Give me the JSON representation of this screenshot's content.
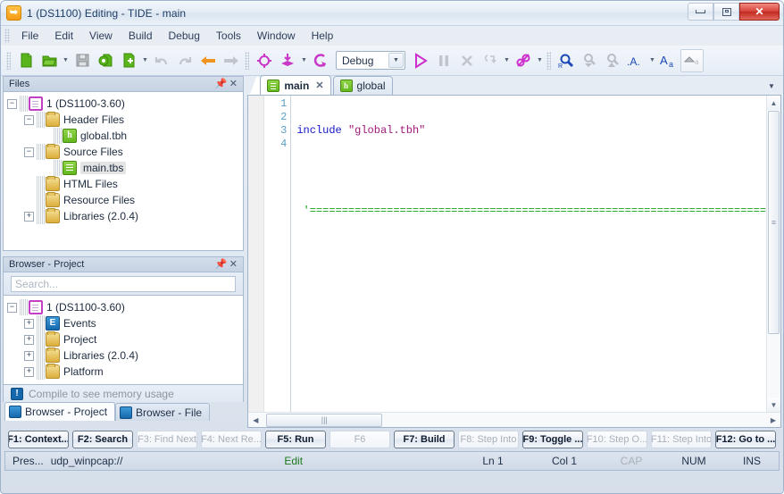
{
  "window": {
    "title": "1 (DS1100) Editing - TIDE - main",
    "app_icon": "tide-logo-icon",
    "controls": {
      "minimize": "minimize-icon",
      "maximize": "maximize-icon",
      "close": "✕"
    }
  },
  "menu": {
    "items": [
      "File",
      "Edit",
      "View",
      "Build",
      "Debug",
      "Tools",
      "Window",
      "Help"
    ]
  },
  "toolbar": {
    "groups": [
      {
        "buttons": [
          {
            "name": "new-file-button",
            "icon": "new-file-icon",
            "dropdown": false
          },
          {
            "name": "open-file-button",
            "icon": "open-folder-icon",
            "dropdown": true
          },
          {
            "name": "save-button",
            "icon": "save-disk-icon",
            "dropdown": false
          },
          {
            "name": "project-settings-button",
            "icon": "file-gear-icon",
            "dropdown": false
          },
          {
            "name": "add-file-button",
            "icon": "file-plus-icon",
            "dropdown": true
          },
          {
            "name": "undo-button",
            "icon": "undo-arrow-icon",
            "dropdown": false
          },
          {
            "name": "redo-button",
            "icon": "redo-arrow-icon",
            "dropdown": false
          },
          {
            "name": "back-button",
            "icon": "arrow-left-icon",
            "dropdown": false
          },
          {
            "name": "forward-button",
            "icon": "arrow-right-icon",
            "dropdown": false
          }
        ]
      },
      {
        "buttons": [
          {
            "name": "target-button",
            "icon": "crosshair-target-icon",
            "dropdown": false
          },
          {
            "name": "download-layers-button",
            "icon": "download-stack-icon",
            "dropdown": true
          },
          {
            "name": "reset-button",
            "icon": "reset-loop-icon",
            "dropdown": false
          }
        ]
      },
      {
        "buttons": [
          {
            "name": "run-button",
            "icon": "play-triangle-icon",
            "dropdown": false
          },
          {
            "name": "pause-button",
            "icon": "pause-bars-icon",
            "dropdown": false
          },
          {
            "name": "stop-button",
            "icon": "stop-x-icon",
            "dropdown": false
          },
          {
            "name": "step-button",
            "icon": "step-brace-icon",
            "dropdown": true
          },
          {
            "name": "breakpoint-button",
            "icon": "breakpoint-link-icon",
            "dropdown": true
          }
        ]
      },
      {
        "buttons": [
          {
            "name": "find-replace-button",
            "icon": "magnifier-r-icon",
            "dropdown": false
          },
          {
            "name": "find-prev-button",
            "icon": "magnifier-down-icon",
            "dropdown": false
          },
          {
            "name": "find-next-button",
            "icon": "magnifier-up-icon",
            "dropdown": false
          },
          {
            "name": "font-size-button",
            "icon": "dot-a-dot-icon",
            "dropdown": true
          },
          {
            "name": "font-button",
            "icon": "big-a-small-a-icon",
            "dropdown": false
          },
          {
            "name": "collapse-button",
            "icon": "collapse-caret-icon",
            "dropdown": false
          }
        ]
      }
    ],
    "config_combo": {
      "value": "Debug",
      "arrow": "chevron-down-icon"
    }
  },
  "files_panel": {
    "title": "Files",
    "pin_icon": "pin-icon",
    "close_icon": "close-icon",
    "tree": [
      {
        "label": "1 (DS1100-3.60)",
        "icon": "project-icon",
        "indent": 0,
        "expander": "minus"
      },
      {
        "label": "Header Files",
        "icon": "folder-icon",
        "indent": 1,
        "expander": "minus"
      },
      {
        "label": "global.tbh",
        "icon": "header-file-icon",
        "indent": 2,
        "expander": "none"
      },
      {
        "label": "Source Files",
        "icon": "folder-icon",
        "indent": 1,
        "expander": "minus"
      },
      {
        "label": "main.tbs",
        "icon": "source-file-icon",
        "indent": 2,
        "expander": "none",
        "selected": true
      },
      {
        "label": "HTML Files",
        "icon": "folder-icon",
        "indent": 1,
        "expander": "none"
      },
      {
        "label": "Resource Files",
        "icon": "folder-icon",
        "indent": 1,
        "expander": "none"
      },
      {
        "label": "Libraries (2.0.4)",
        "icon": "folder-icon",
        "indent": 1,
        "expander": "plus"
      }
    ]
  },
  "browser_panel": {
    "title": "Browser - Project",
    "pin_icon": "pin-icon",
    "close_icon": "close-icon",
    "search": {
      "value": "",
      "placeholder": "Search..."
    },
    "tree": [
      {
        "label": "1 (DS1100-3.60)",
        "icon": "project-icon",
        "indent": 0,
        "expander": "minus"
      },
      {
        "label": "Events",
        "icon": "events-icon",
        "indent": 1,
        "expander": "plus"
      },
      {
        "label": "Project",
        "icon": "folder-icon",
        "indent": 1,
        "expander": "plus"
      },
      {
        "label": "Libraries (2.0.4)",
        "icon": "folder-icon",
        "indent": 1,
        "expander": "plus"
      },
      {
        "label": "Platform",
        "icon": "folder-icon",
        "indent": 1,
        "expander": "plus"
      }
    ],
    "memory_note": "Compile to see memory usage",
    "memory_icon": "info-exclamation-icon",
    "tabs": [
      {
        "label": "Browser - Project",
        "icon": "browser-project-icon",
        "active": true
      },
      {
        "label": "Browser - File",
        "icon": "browser-file-icon",
        "active": false
      }
    ]
  },
  "editor": {
    "tabs": [
      {
        "label": "main",
        "icon": "source-file-icon",
        "active": true,
        "closable": true
      },
      {
        "label": "global",
        "icon": "header-file-icon",
        "active": false,
        "closable": false
      }
    ],
    "overflow_icon": "chevron-down-icon",
    "line_numbers": [
      "1",
      "2",
      "3",
      "4"
    ],
    "lines": [
      {
        "n": 1,
        "segments": [
          {
            "t": "include",
            "c": "kw"
          },
          {
            "t": " ",
            "c": ""
          },
          {
            "t": "\"global.tbh\"",
            "c": "str"
          }
        ]
      },
      {
        "n": 2,
        "segments": []
      },
      {
        "n": 3,
        "segments": [
          {
            "t": " '=======================================================================",
            "c": "cmt"
          }
        ]
      },
      {
        "n": 4,
        "segments": []
      }
    ],
    "vscroll": {
      "up": "scroll-up-icon",
      "down": "scroll-down-icon",
      "grip": "≡"
    },
    "hscroll": {
      "left": "scroll-left-icon",
      "right": "scroll-right-icon",
      "grip": "|||"
    }
  },
  "fkeys": [
    {
      "label": "F1: Context...",
      "state": "on"
    },
    {
      "label": "F2: Search",
      "state": "on"
    },
    {
      "label": "F3: Find Next",
      "state": "off"
    },
    {
      "label": "F4: Next Re...",
      "state": "off"
    },
    {
      "label": "F5: Run",
      "state": "on"
    },
    {
      "label": "F6",
      "state": "off"
    },
    {
      "label": "F7: Build",
      "state": "on"
    },
    {
      "label": "F8: Step Into",
      "state": "off"
    },
    {
      "label": "F9: Toggle ...",
      "state": "on"
    },
    {
      "label": "F10: Step O...",
      "state": "off"
    },
    {
      "label": "F11: Step Into",
      "state": "off"
    },
    {
      "label": "F12: Go to ...",
      "state": "on"
    }
  ],
  "statusbar": {
    "message": "Pres...",
    "connection": "udp_winpcap://",
    "mode": "Edit",
    "line": "Ln 1",
    "col": "Col 1",
    "caps": "CAP",
    "num": "NUM",
    "ins": "INS"
  }
}
